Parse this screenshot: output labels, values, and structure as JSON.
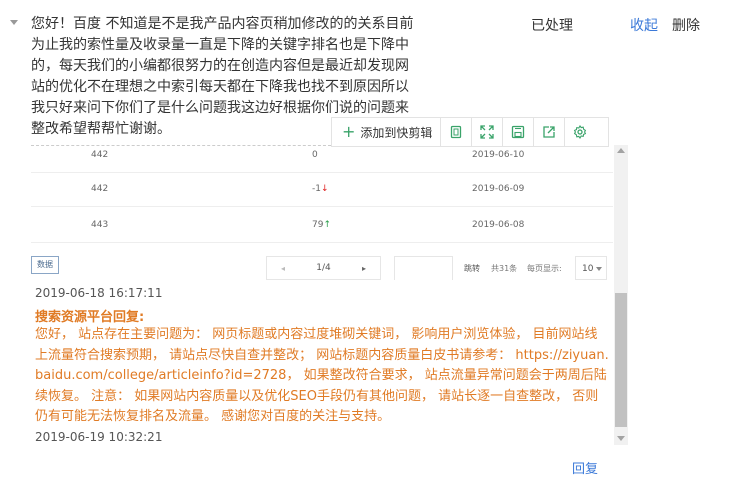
{
  "question": {
    "text": "您好！百度 不知道是不是我产品内容页稍加修改的的关系目前为止我的索性量及收录量一直是下降的关键字排名也是下降中的，每天我们的小编都很努力的在创造内容但是最近却发现网站的优化不在理想之中索引每天都在下降我也找不到原因所以我只好来问下你们了是什么问题我这边好根据你们说的问题来整改希望帮帮忙谢谢。",
    "status": "已处理",
    "collapse_label": "收起",
    "delete_label": "删除"
  },
  "toolbar": {
    "add_label": "添加到快剪辑",
    "icons": [
      "copy-icon",
      "expand-icon",
      "save-icon",
      "share-icon",
      "settings-icon"
    ]
  },
  "screenshot_table": {
    "rows": [
      {
        "col1": "442",
        "col2": "0",
        "trend": "",
        "date": "2019-06-10"
      },
      {
        "col1": "442",
        "col2": "-1",
        "trend": "↓",
        "date": "2019-06-09"
      },
      {
        "col1": "443",
        "col2": "79",
        "trend": "↑",
        "date": "2019-06-08"
      }
    ],
    "export_label": "数据",
    "pager": {
      "prev": "◂",
      "page": "1/4",
      "next": "▸"
    },
    "jump_label": "跳转",
    "total_label": "共31条",
    "per_page_label": "每页显示:",
    "per_page_value": "10"
  },
  "timestamps": {
    "question_time": "2019-06-18 16:17:11",
    "reply_time": "2019-06-19 10:32:21"
  },
  "reply": {
    "title": "搜索资源平台回复:",
    "body": "您好， 站点存在主要问题为： 网页标题或内容过度堆砌关键词， 影响用户浏览体验， 目前网站线上流量符合搜索预期， 请站点尽快自查并整改； 网站标题内容质量白皮书请参考： https://ziyuan.baidu.com/college/articleinfo?id=2728， 如果整改符合要求， 站点流量异常问题会于两周后陆续恢复。 注意： 如果网站内容质量以及优化SEO手段仍有其他问题， 请站长逐一自查整改， 否则仍有可能无法恢复排名及流量。 感谢您对百度的关注与支持。",
    "reply_link": "回复"
  },
  "colors": {
    "link": "#3b79d8",
    "reply_text": "#e07b25",
    "trend_down": "#e02020",
    "trend_up": "#2a9d4a"
  }
}
